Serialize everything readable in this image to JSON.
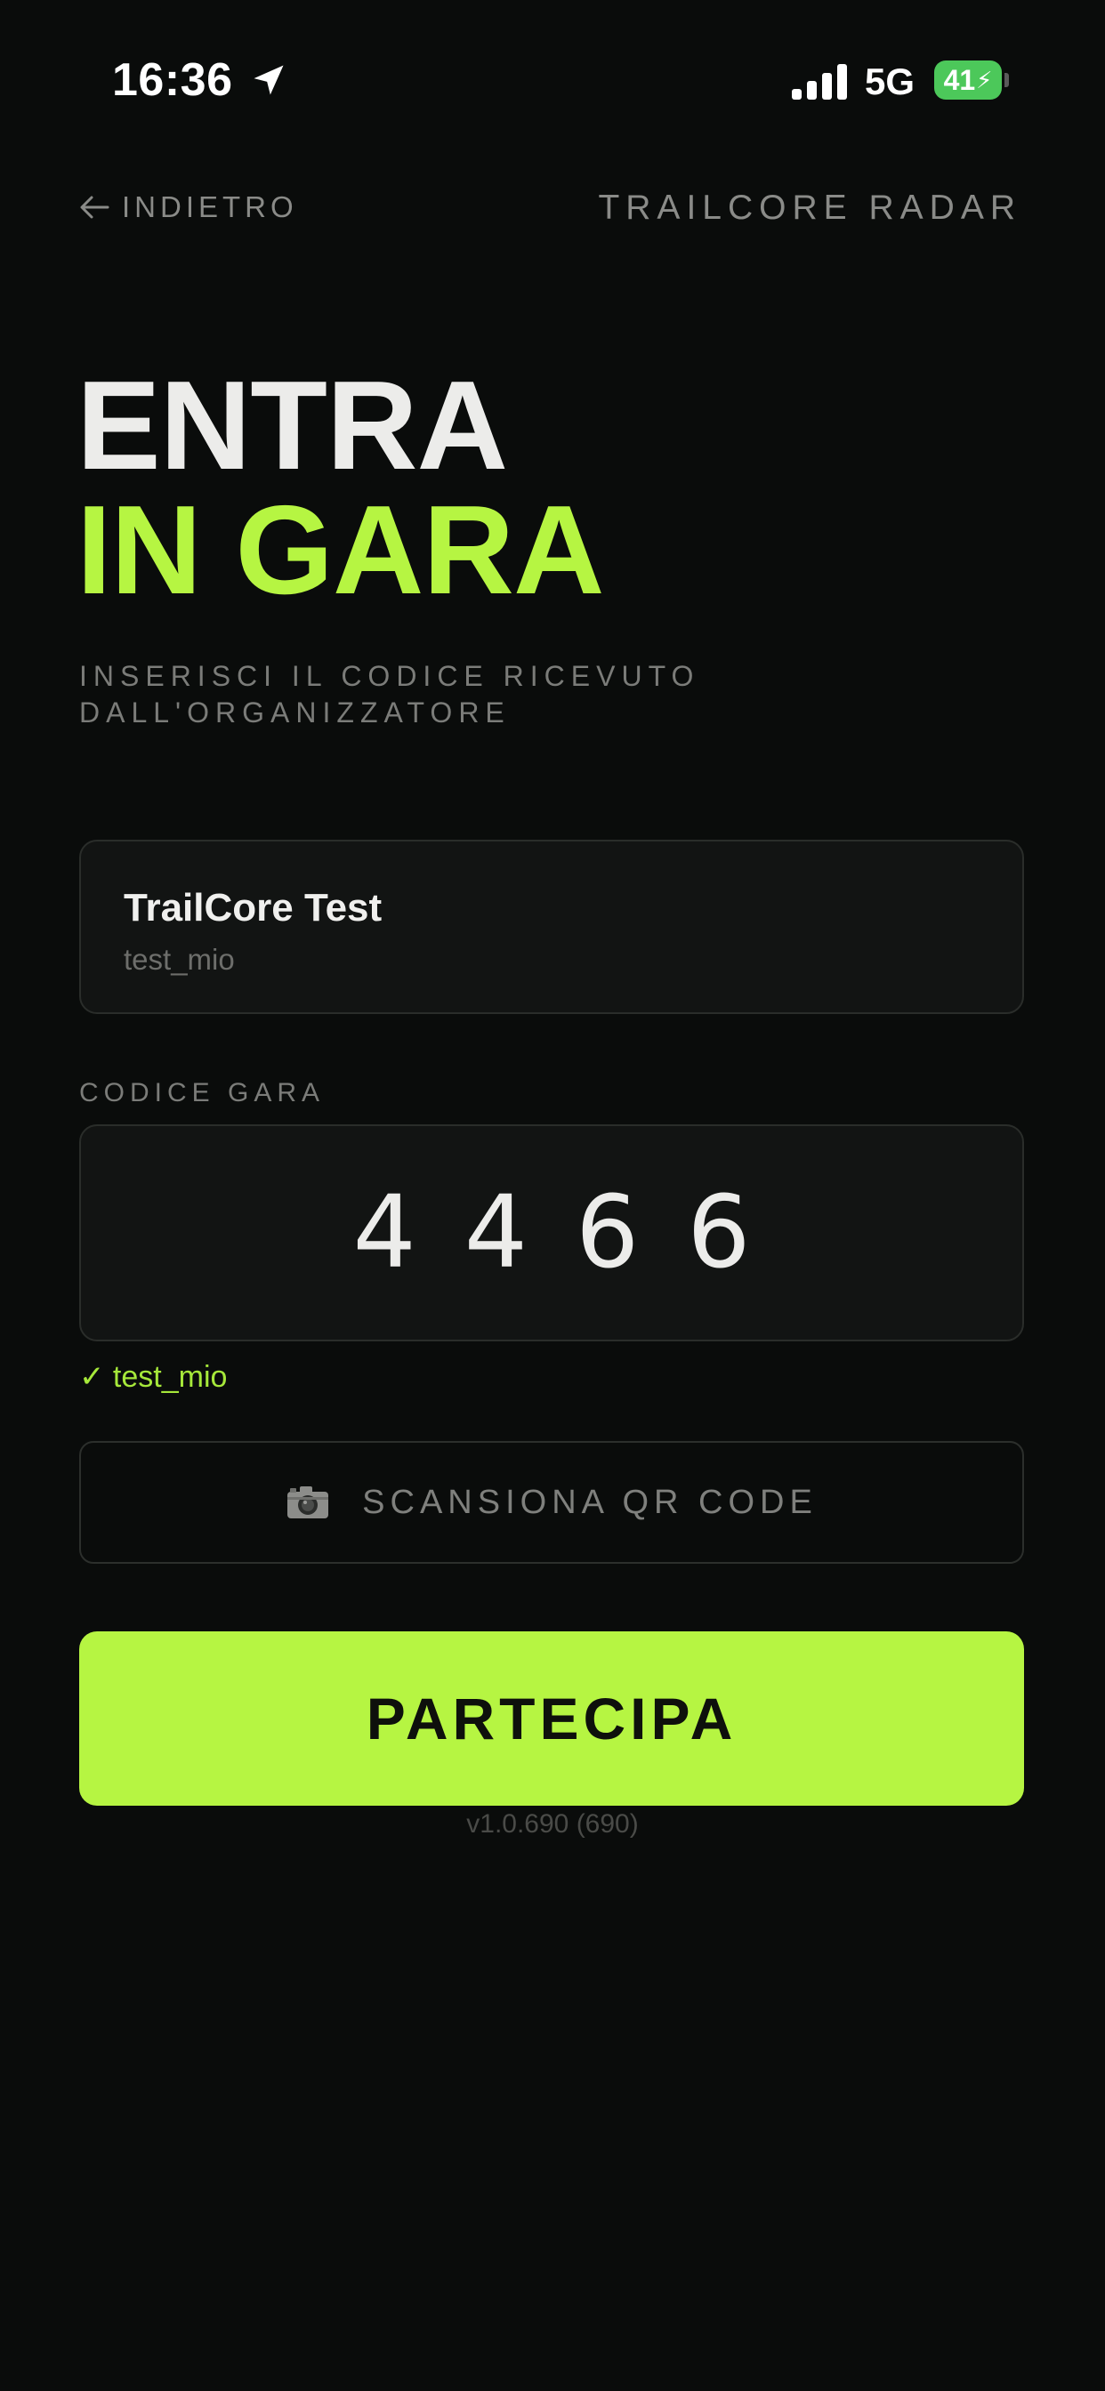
{
  "status_bar": {
    "time": "16:36",
    "network": "5G",
    "battery": "41"
  },
  "nav": {
    "back_label": "INDIETRO",
    "brand": "TRAILCORE RADAR"
  },
  "hero": {
    "title_line1": "ENTRA",
    "title_line2": "IN GARA",
    "subtitle": "INSERISCI IL CODICE RICEVUTO DALL'ORGANIZZATORE"
  },
  "event": {
    "name": "TrailCore Test",
    "id": "test_mio"
  },
  "code": {
    "label": "CODICE GARA",
    "value": "4466",
    "valid_text": "✓ test_mio"
  },
  "scan": {
    "label": "SCANSIONA QR CODE",
    "icon": "camera-icon"
  },
  "primary": {
    "label": "PARTECIPA"
  },
  "version": "v1.0.690 (690)",
  "colors": {
    "background": "#0a0c0b",
    "accent": "#b6f542",
    "text": "#ececea",
    "muted": "#7b7c79",
    "battery": "#4cc85a"
  }
}
